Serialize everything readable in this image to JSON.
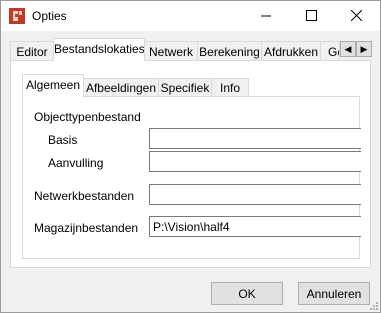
{
  "window": {
    "title": "Opties",
    "icon": "app-logo-icon",
    "controls": [
      "minimize-icon",
      "maximize-icon",
      "close-icon"
    ]
  },
  "outer_tabs": [
    {
      "label": "Editor"
    },
    {
      "label": "Bestandslokaties",
      "active": true
    },
    {
      "label": "Netwerk"
    },
    {
      "label": "Berekening"
    },
    {
      "label": "Afdrukken"
    },
    {
      "label": "Ge"
    }
  ],
  "tab_scroll": {
    "left": "◀",
    "right": "▶"
  },
  "inner_tabs": [
    {
      "label": "Algemeen",
      "active": true
    },
    {
      "label": "Afbeeldingen"
    },
    {
      "label": "Specifiek"
    },
    {
      "label": "Info"
    }
  ],
  "form": {
    "group_label": "Objecttypenbestand",
    "basis_label": "Basis",
    "basis_value": "",
    "aanvulling_label": "Aanvulling",
    "aanvulling_value": "",
    "netwerk_label": "Netwerkbestanden",
    "netwerk_value": "",
    "magazijn_label": "Magazijnbestanden",
    "magazijn_value": "P:\\Vision\\half4"
  },
  "buttons": {
    "ok": "OK",
    "cancel": "Annuleren"
  }
}
